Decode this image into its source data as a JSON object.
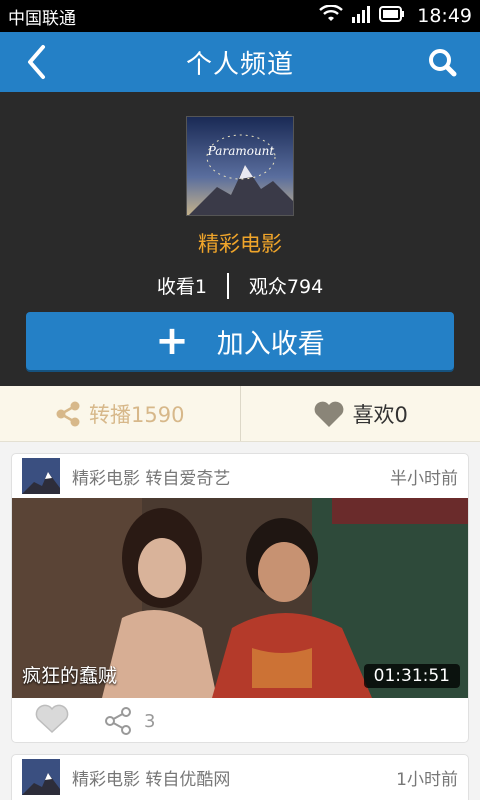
{
  "status_bar": {
    "carrier": "中国联通",
    "time": "18:49"
  },
  "header": {
    "title": "个人频道",
    "back_icon": "chevron-left-icon",
    "search_icon": "search-icon"
  },
  "profile": {
    "name": "精彩电影",
    "following_label": "收看1",
    "audience_label": "观众794",
    "follow_button": "加入收看"
  },
  "actions": {
    "share_label": "转播1590",
    "like_label": "喜欢0"
  },
  "feed": [
    {
      "source": "精彩电影 转自爱奇艺",
      "time": "半小时前",
      "video_title": "疯狂的蠢贼",
      "duration": "01:31:51",
      "share_count": "3"
    },
    {
      "source": "精彩电影 转自优酷网",
      "time": "1小时前"
    }
  ],
  "colors": {
    "accent": "#2480c6",
    "name": "#f0a52a",
    "profile_bg": "#2a2a2a",
    "actions_bg": "#fbf7ea"
  }
}
